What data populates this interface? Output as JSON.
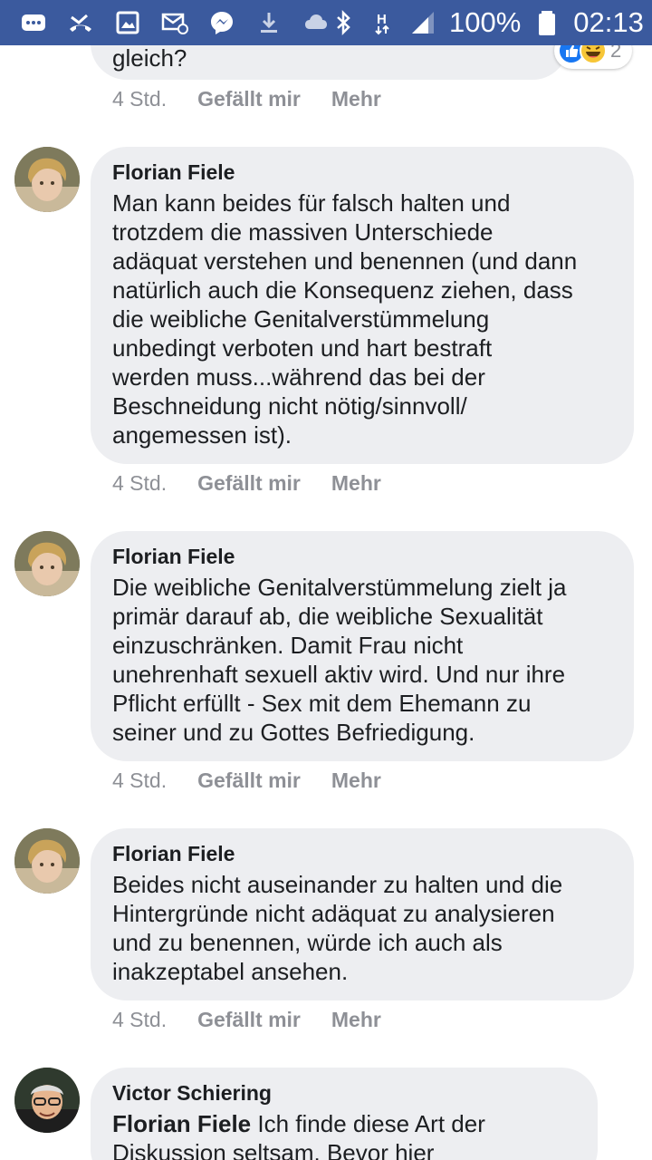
{
  "status_bar": {
    "battery": "100%",
    "time": "02:13",
    "icons": [
      "message-icon",
      "missed-call-icon",
      "image-icon",
      "email-icon",
      "messenger-icon",
      "download-icon",
      "cloud-icon",
      "bluetooth-icon",
      "hsdpa-icon",
      "signal-icon",
      "battery-icon"
    ]
  },
  "colors": {
    "status_bar_bg": "#3b5a9e",
    "bubble_bg": "#edeef1",
    "meta_text": "#8e9096",
    "text": "#1c1e21",
    "like_blue": "#1877f2"
  },
  "top_comment": {
    "text_tail": "gleich?",
    "reaction_count": "2",
    "time": "4 Std.",
    "like_label": "Gefällt mir",
    "more_label": "Mehr"
  },
  "comments": [
    {
      "author": "Florian Fiele",
      "lines": [
        "Man kann beides für falsch halten und",
        "trotzdem die massiven Unterschiede",
        "adäquat verstehen und benennen (und dann",
        "natürlich auch die Konsequenz ziehen, dass",
        "die weibliche Genitalverstümmelung",
        "unbedingt verboten und hart bestraft",
        "werden muss...während das bei der",
        "Beschneidung nicht nötig/sinnvoll/",
        "angemessen ist)."
      ],
      "time": "4 Std.",
      "like_label": "Gefällt mir",
      "more_label": "Mehr"
    },
    {
      "author": "Florian Fiele",
      "lines": [
        "Die weibliche Genitalverstümmelung zielt ja",
        "primär darauf ab, die weibliche Sexualität",
        "einzuschränken. Damit Frau nicht",
        "unehrenhaft sexuell aktiv wird. Und nur ihre",
        "Pflicht erfüllt - Sex mit dem Ehemann zu",
        "seiner und zu Gottes Befriedigung."
      ],
      "time": "4 Std.",
      "like_label": "Gefällt mir",
      "more_label": "Mehr"
    },
    {
      "author": "Florian Fiele",
      "lines": [
        "Beides nicht auseinander zu halten und die",
        "Hintergründe nicht adäquat zu analysieren",
        "und zu benennen, würde ich auch als",
        "inakzeptabel ansehen."
      ],
      "time": "4 Std.",
      "like_label": "Gefällt mir",
      "more_label": "Mehr"
    }
  ],
  "last_comment": {
    "author": "Victor Schiering",
    "mention": "Florian Fiele",
    "line1_rest": " Ich finde diese Art der",
    "line2": "Diskussion seltsam. Bevor hier"
  }
}
